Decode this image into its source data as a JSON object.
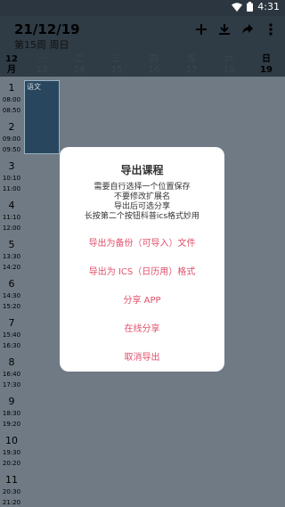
{
  "status": {
    "time": "4:31"
  },
  "header": {
    "date": "21/12/19",
    "week": "第15周 周日"
  },
  "actions": [
    {
      "name": "add-icon",
      "glyph": "+"
    },
    {
      "name": "download-icon",
      "glyph": ""
    },
    {
      "name": "share-icon",
      "glyph": ""
    },
    {
      "name": "more-icon",
      "glyph": ""
    }
  ],
  "days": {
    "month": "12",
    "month_unit": "月",
    "cols": [
      {
        "weekday": "一",
        "date": "13"
      },
      {
        "weekday": "二",
        "date": "14"
      },
      {
        "weekday": "三",
        "date": "15"
      },
      {
        "weekday": "四",
        "date": "16"
      },
      {
        "weekday": "五",
        "date": "17"
      },
      {
        "weekday": "六",
        "date": "18"
      },
      {
        "weekday": "日",
        "date": "19"
      }
    ]
  },
  "slots": [
    {
      "n": "1",
      "start": "08:00",
      "end": "08:50"
    },
    {
      "n": "2",
      "start": "09:00",
      "end": "09:50"
    },
    {
      "n": "3",
      "start": "10:10",
      "end": "11:00"
    },
    {
      "n": "4",
      "start": "11:10",
      "end": "12:00"
    },
    {
      "n": "5",
      "start": "13:30",
      "end": "14:20"
    },
    {
      "n": "6",
      "start": "14:30",
      "end": "15:20"
    },
    {
      "n": "7",
      "start": "15:40",
      "end": "16:30"
    },
    {
      "n": "8",
      "start": "16:40",
      "end": "17:30"
    },
    {
      "n": "9",
      "start": "18:30",
      "end": "19:20"
    },
    {
      "n": "10",
      "start": "19:30",
      "end": "20:20"
    },
    {
      "n": "11",
      "start": "20:30",
      "end": "21:20"
    }
  ],
  "course": {
    "name": "语文"
  },
  "dialog": {
    "title": "导出课程",
    "desc": [
      "需要自行选择一个位置保存",
      "不要修改扩展名",
      "导出后可选分享",
      "长按第二个按钮科普ics格式妙用"
    ],
    "options": [
      "导出为备份（可导入）文件",
      "导出为 ICS（日历用）格式",
      "分享 APP",
      "在线分享",
      "取消导出"
    ]
  }
}
